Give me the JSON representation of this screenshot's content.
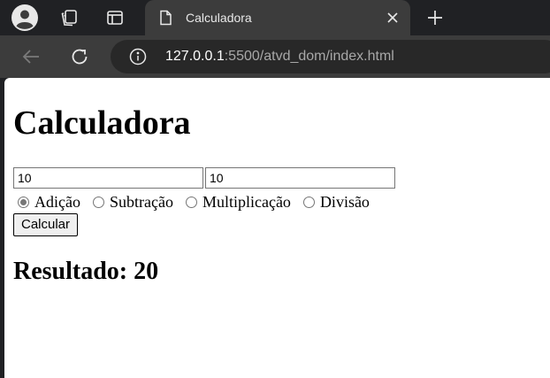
{
  "browser": {
    "tab": {
      "title": "Calculadora"
    },
    "address_bar": {
      "host": "127.0.0.1",
      "path": ":5500/atvd_dom/index.html"
    }
  },
  "page": {
    "heading": "Calculadora",
    "inputs": {
      "first_value": "10",
      "second_value": "10"
    },
    "operations": [
      {
        "label": "Adição",
        "checked": true
      },
      {
        "label": "Subtração",
        "checked": false
      },
      {
        "label": "Multiplicação",
        "checked": false
      },
      {
        "label": "Divisão",
        "checked": false
      }
    ],
    "calculate_label": "Calcular",
    "result_text": "Resultado: 20"
  },
  "colors": {
    "tabstrip_bg": "#202124",
    "toolbar_bg": "#3c3c3c",
    "omnibox_bg": "#282828",
    "page_bg": "#ffffff"
  }
}
